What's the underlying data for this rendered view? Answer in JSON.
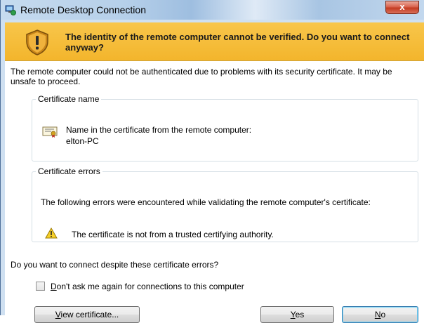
{
  "window": {
    "title": "Remote Desktop Connection",
    "close_label": "x"
  },
  "banner": {
    "message": "The identity of the remote computer cannot be verified. Do you want to connect anyway?"
  },
  "intro_text": "The remote computer could not be authenticated due to problems with its security certificate. It may be unsafe to proceed.",
  "certificate_name": {
    "legend": "Certificate name",
    "line1": "Name in the certificate from the remote computer:",
    "line2": "elton-PC"
  },
  "certificate_errors": {
    "legend": "Certificate errors",
    "description": "The following errors were encountered while validating the remote computer's certificate:",
    "error1": "The certificate is not from a trusted certifying authority."
  },
  "question": "Do you want to connect despite these certificate errors?",
  "checkbox": {
    "label_first": "D",
    "label_rest": "on't ask me again for connections to this computer",
    "checked": false
  },
  "buttons": {
    "view_first": "V",
    "view_rest": "iew certificate...",
    "yes_first": "Y",
    "yes_rest": "es",
    "no_first": "N",
    "no_rest": "o"
  },
  "colors": {
    "banner": "#f3b52c",
    "titlebar": "#b9d1ea",
    "close": "#c43b21"
  }
}
